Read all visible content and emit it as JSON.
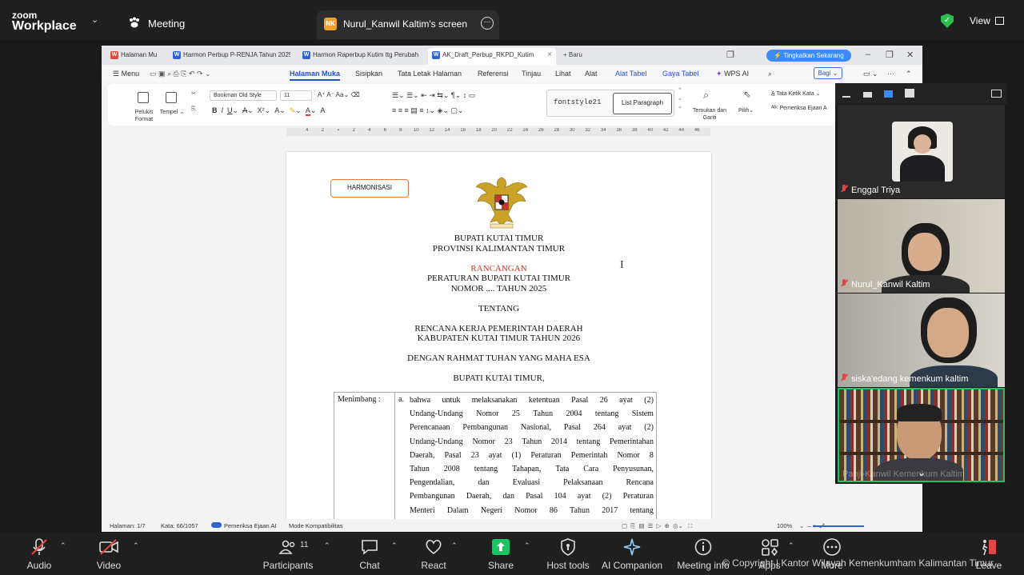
{
  "zoom": {
    "logo_line1": "zoom",
    "logo_line2": "Workplace",
    "meeting_label": "Meeting",
    "share_initials": "NK",
    "share_label": "Nurul_Kanwil Kaltim's screen",
    "view_label": "View"
  },
  "wps": {
    "tabs": [
      {
        "label": "Halaman Mu"
      },
      {
        "label": "Harmon Perbup P-RENJA Tahun 2025"
      },
      {
        "label": "Harmon Raperbup Kutim ttg Perubah"
      },
      {
        "label": "AK_Draft_Perbup_RKPD_Kutim"
      }
    ],
    "new_tab": "+ Baru",
    "upgrade": "⚡ Tingkatkan Sekarang",
    "menu": {
      "menu": "Menu",
      "items": [
        "Halaman Muka",
        "Sisipkan",
        "Tata Letak Halaman",
        "Referensi",
        "Tinjau",
        "Lihat",
        "Alat",
        "Alat Tabel",
        "Gaya Tabel",
        "WPS AI"
      ],
      "share": "Bagi"
    },
    "ribbon": {
      "format_painter": "Pelukis Format",
      "paste": "Tempel",
      "font_name": "Bookman Old Style",
      "font_size": "11",
      "style_1": "fontstyle21",
      "style_2": "List Paragraph",
      "find_replace": "Temukan dan Ganti",
      "select": "Pilih",
      "word_count_tool": "Tata Ketik Kata",
      "spell_check": "Pemeriksa Ejaan A"
    },
    "ruler": [
      "4",
      "2",
      "",
      "2",
      "4",
      "6",
      "8",
      "10",
      "12",
      "14",
      "16",
      "18",
      "20",
      "22",
      "24",
      "26",
      "28",
      "30",
      "32",
      "34",
      "36",
      "38",
      "40",
      "42",
      "44",
      "46"
    ],
    "document": {
      "stamp": "HARMONISASI",
      "line1": "BUPATI KUTAI TIMUR",
      "line2": "PROVINSI KALIMANTAN TIMUR",
      "draft": "RANCANGAN",
      "reg1": "PERATURAN BUPATI KUTAI TIMUR",
      "reg2": "NOMOR .... TAHUN 2025",
      "about": "TENTANG",
      "subject1": "RENCANA KERJA PEMERINTAH DAERAH",
      "subject2": "KABUPATEN KUTAI TIMUR TAHUN 2026",
      "blessing": "DENGAN RAHMAT TUHAN YANG MAHA ESA",
      "regent": "BUPATI KUTAI TIMUR,",
      "considering": "Menimbang :",
      "point": "a.",
      "paragraph": [
        "bahwa untuk melaksanakan ketentuan Pasal 26 ayat (2)",
        "Undang-Undang Nomor 25 Tahun 2004 tentang Sistem",
        "Perencanaan Pembangunan Nasional, Pasal 264 ayat (2)",
        "Undang-Undang Nomor 23 Tahun 2014 tentang Pemerintahan",
        "Daerah, Pasal 23 ayat (1) Peraturan Pemerintah Nomor 8",
        "Tahun 2008 tentang Tahapan, Tata Cara Penyusunan,",
        "Pengendalian, dan Evaluasi Pelaksanaan Rencana",
        "Pembangunan Daerah, dan Pasal 104 ayat (2) Peraturan",
        "Menteri Dalam Negeri Nomor 86 Tahun 2017 tentang"
      ]
    },
    "status": {
      "page": "Halaman: 1/7",
      "words": "Kata: 66/1057",
      "spell": "Pemeriksa Ejaan AI",
      "compat": "Mode Kompatibilitas",
      "zoom": "100%"
    }
  },
  "participants": [
    {
      "name": "Enggal Triya"
    },
    {
      "name": "Nurul_Kanwil Kaltim"
    },
    {
      "name": "siska'edang kemenkum kaltim"
    },
    {
      "name": "Panji-Kanwil Kemenkum Kaltim"
    }
  ],
  "toolbar": {
    "audio": "Audio",
    "video": "Video",
    "participants": "Participants",
    "participants_count": "11",
    "chat": "Chat",
    "react": "React",
    "share": "Share",
    "host_tools": "Host tools",
    "ai_companion": "AI Companion",
    "meeting_info": "Meeting info",
    "apps": "Apps",
    "more": "More",
    "leave": "Leave"
  },
  "watermark": "© Copyright | Kantor Wilayah Kemenkumham Kalimantan Timur",
  "colors": {
    "share_green": "#19c463",
    "zoom_bar": "#1f1f1f",
    "accent_blue": "#2452c8"
  }
}
